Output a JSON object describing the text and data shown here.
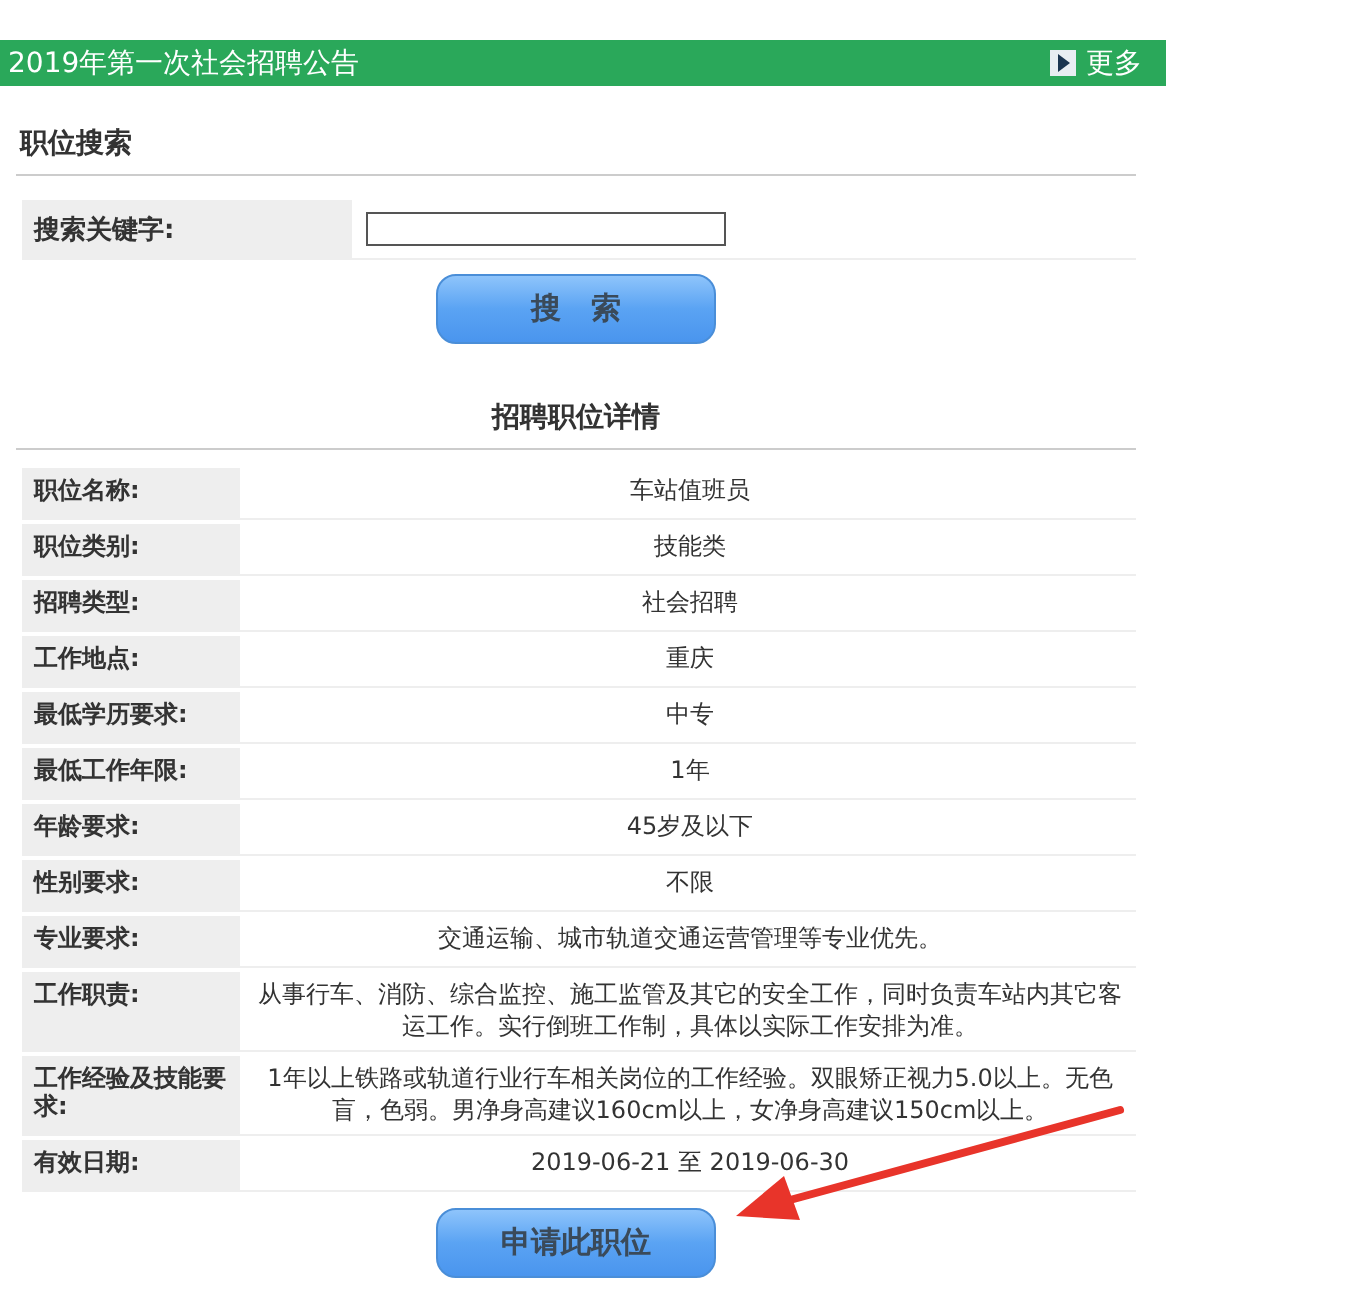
{
  "header": {
    "title": "2019年第一次社会招聘公告",
    "more_link": "更多"
  },
  "search": {
    "heading": "职位搜索",
    "field_label": "搜索关键字:",
    "button": "搜　索"
  },
  "details": {
    "heading": "招聘职位详情",
    "rows": [
      {
        "label": "职位名称:",
        "value": "车站值班员"
      },
      {
        "label": "职位类别:",
        "value": "技能类"
      },
      {
        "label": "招聘类型:",
        "value": "社会招聘"
      },
      {
        "label": "工作地点:",
        "value": "重庆"
      },
      {
        "label": "最低学历要求:",
        "value": "中专"
      },
      {
        "label": "最低工作年限:",
        "value": "1年"
      },
      {
        "label": "年龄要求:",
        "value": "45岁及以下"
      },
      {
        "label": "性别要求:",
        "value": "不限"
      },
      {
        "label": "专业要求:",
        "value": "交通运输、城市轨道交通运营管理等专业优先。"
      },
      {
        "label": "工作职责:",
        "value": "从事行车、消防、综合监控、施工监管及其它的安全工作，同时负责车站内其它客运工作。实行倒班工作制，具体以实际工作安排为准。"
      },
      {
        "label": "工作经验及技能要求:",
        "value": "1年以上铁路或轨道行业行车相关岗位的工作经验。双眼矫正视力5.0以上。无色盲，色弱。男净身高建议160cm以上，女净身高建议150cm以上。"
      },
      {
        "label": "有效日期:",
        "value": "2019-06-21 至 2019-06-30"
      }
    ],
    "apply_button": "申请此职位"
  }
}
